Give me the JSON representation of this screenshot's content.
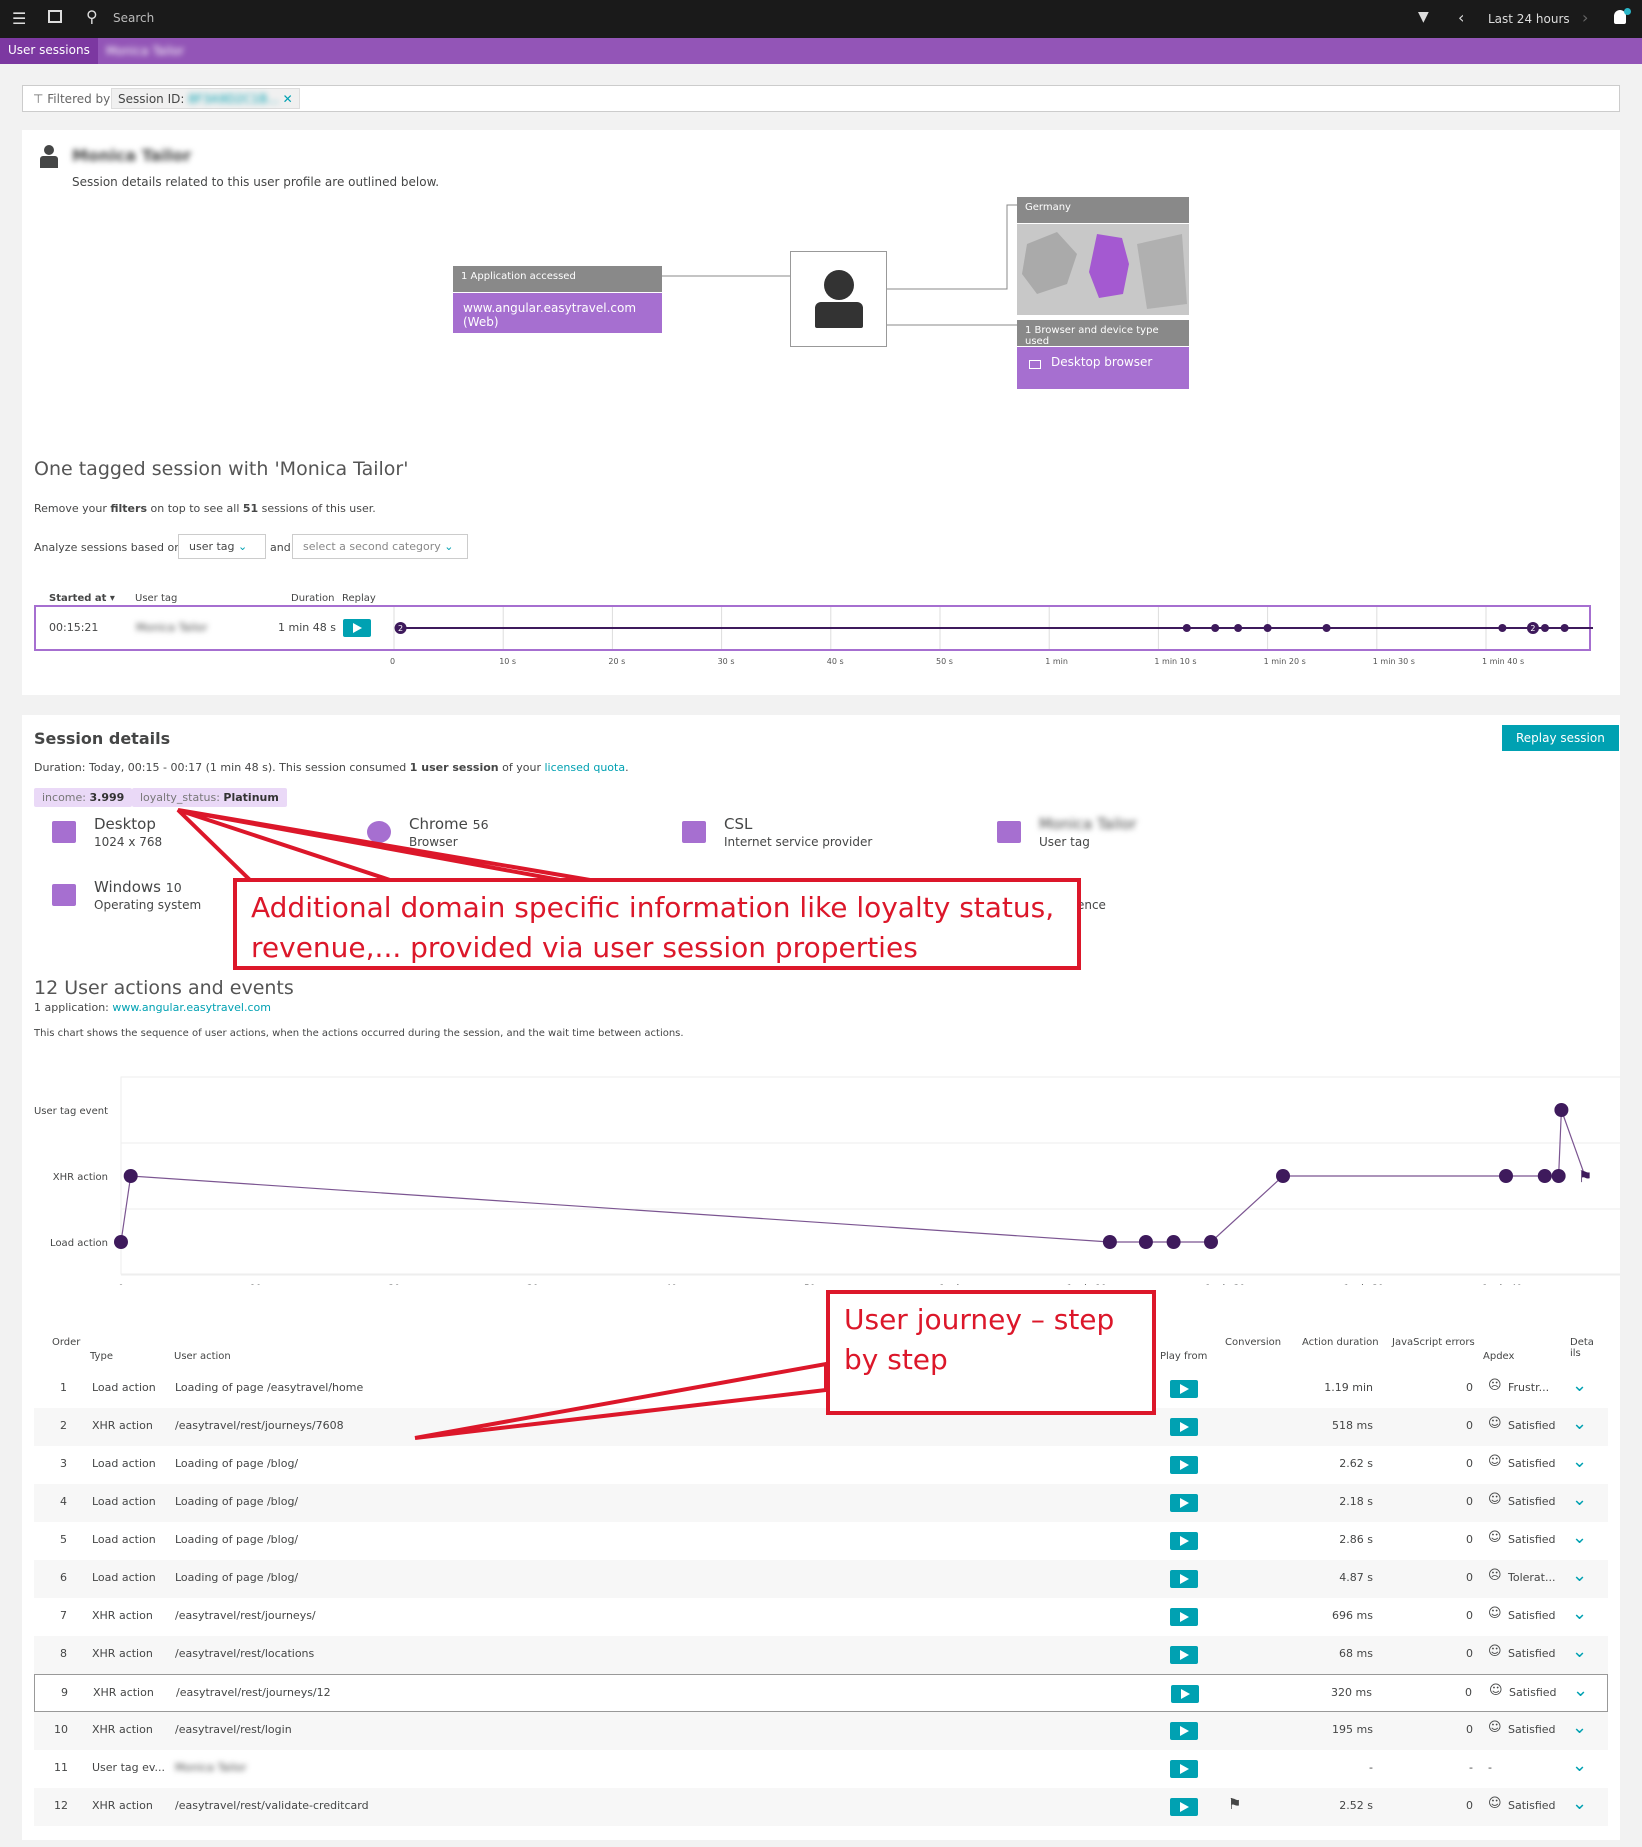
{
  "topbar": {
    "search_placeholder": "Search",
    "timeframe": "Last 24 hours"
  },
  "breadcrumb": {
    "root": "User sessions",
    "current": "Monica Tailor"
  },
  "filter": {
    "label": "Filtered by",
    "chip_key": "Session ID:",
    "chip_value": "8F3A9D2C1B..."
  },
  "profile": {
    "name": "Monica Tailor",
    "subtitle": "Session details related to this user profile are outlined below.",
    "app_header": "1 Application accessed",
    "app_value": "www.angular.easytravel.com (Web)",
    "country": "Germany",
    "browser_header": "1 Browser and device type used",
    "browser_value": "Desktop browser"
  },
  "tagged": {
    "title": "One tagged session with 'Monica Tailor'",
    "remove_pre": "Remove your ",
    "remove_filters": "filters",
    "remove_mid": " on top to see all ",
    "remove_count": "51",
    "remove_post": " sessions of this user.",
    "analyze_label": "Analyze sessions based on",
    "first_category": "user tag",
    "and": "and",
    "second_category": "select a second category",
    "columns": {
      "started": "Started at",
      "user_tag": "User tag",
      "duration": "Duration",
      "replay": "Replay"
    },
    "session": {
      "started": "00:15:21",
      "user_tag": "Monica Tailor",
      "duration": "1 min 48 s"
    },
    "ticks": [
      "0",
      "10 s",
      "20 s",
      "30 s",
      "40 s",
      "50 s",
      "1 min",
      "1 min 10 s",
      "1 min 20 s",
      "1 min 30 s",
      "1 min 40 s"
    ],
    "events_s": [
      0.6,
      72.6,
      75.2,
      77.3,
      80,
      85.4,
      101.5,
      104.3,
      105.4,
      107.2
    ],
    "badges": {
      "first": "2",
      "ninth": "2"
    }
  },
  "details": {
    "title": "Session details",
    "replay_button": "Replay session",
    "duration_pre": "Duration: Today, 00:15 - 00:17 (1 min 48 s). This session consumed ",
    "duration_bold": "1 user session",
    "duration_mid": " of your ",
    "quota_link": "licensed quota",
    "duration_post": ".",
    "properties": [
      {
        "key": "income:",
        "value": "3.999"
      },
      {
        "key": "loyalty_status:",
        "value": "Platinum"
      }
    ],
    "info": [
      {
        "icon": "desktop-icon",
        "title": "Desktop",
        "sub": "1024 x 768"
      },
      {
        "icon": "chrome-icon",
        "title": "Chrome",
        "ver": "56",
        "sub": "Browser"
      },
      {
        "icon": "isp-icon",
        "title": "CSL",
        "sub": "Internet service provider"
      },
      {
        "icon": "tag-icon",
        "title": "Monica Tailor",
        "sub": "User tag"
      },
      {
        "icon": "windows-icon",
        "title": "Windows",
        "ver": "10",
        "sub": "Operating system"
      },
      {
        "icon": "experience-icon",
        "title": "ated",
        "sub": "Experience"
      }
    ]
  },
  "annotation1": "Additional domain specific information like loyalty status, revenue,... provided via user session properties",
  "annotation2": "User journey – step by step",
  "actions": {
    "title": "12 User actions and events",
    "app_pre": "1 application: ",
    "app_link": "www.angular.easytravel.com",
    "description": "This chart shows the sequence of user actions, when the actions occurred during the session, and the wait time between actions."
  },
  "chart_data": {
    "type": "scatter",
    "categories": [
      "User tag event",
      "XHR action",
      "Load action"
    ],
    "x_ticks": [
      "0",
      "10 s",
      "20 s",
      "30 s",
      "40 s",
      "50 s",
      "1 min",
      "1 min 10 s",
      "1 min 20 s",
      "1 min 30 s",
      "1 min 40 s"
    ],
    "xlim": [
      0,
      107
    ],
    "points": [
      {
        "x": 0,
        "y": "Load action"
      },
      {
        "x": 0.7,
        "y": "XHR action"
      },
      {
        "x": 71.4,
        "y": "Load action"
      },
      {
        "x": 74,
        "y": "Load action"
      },
      {
        "x": 76,
        "y": "Load action"
      },
      {
        "x": 78.7,
        "y": "Load action"
      },
      {
        "x": 83.9,
        "y": "XHR action"
      },
      {
        "x": 100,
        "y": "XHR action"
      },
      {
        "x": 102.8,
        "y": "XHR action"
      },
      {
        "x": 103.8,
        "y": "XHR action"
      },
      {
        "x": 104,
        "y": "User tag event"
      },
      {
        "x": 105.7,
        "y": "XHR action",
        "marker": "flag"
      }
    ],
    "colors": {
      "point": "#3e1a5c",
      "line": "#7b5591"
    }
  },
  "table": {
    "headers": {
      "order": "Order",
      "type": "Type",
      "action": "User action",
      "play": "Play from",
      "conversion": "Conversion",
      "duration": "Action duration",
      "js": "JavaScript errors",
      "apdex": "Apdex",
      "details": "Details"
    },
    "rows": [
      [
        "1",
        "Load action",
        "Loading of page /easytravel/home",
        "",
        "1.19 min",
        "0",
        "Frustr..."
      ],
      [
        "2",
        "XHR action",
        "/easytravel/rest/journeys/7608",
        "",
        "518 ms",
        "0",
        "Satisfied"
      ],
      [
        "3",
        "Load action",
        "Loading of page /blog/",
        "",
        "2.62 s",
        "0",
        "Satisfied"
      ],
      [
        "4",
        "Load action",
        "Loading of page /blog/",
        "",
        "2.18 s",
        "0",
        "Satisfied"
      ],
      [
        "5",
        "Load action",
        "Loading of page /blog/",
        "",
        "2.86 s",
        "0",
        "Satisfied"
      ],
      [
        "6",
        "Load action",
        "Loading of page /blog/",
        "",
        "4.87 s",
        "0",
        "Tolerat..."
      ],
      [
        "7",
        "XHR action",
        "/easytravel/rest/journeys/",
        "",
        "696 ms",
        "0",
        "Satisfied"
      ],
      [
        "8",
        "XHR action",
        "/easytravel/rest/locations",
        "",
        "68 ms",
        "0",
        "Satisfied"
      ],
      [
        "9",
        "XHR action",
        "/easytravel/rest/journeys/12",
        "",
        "320 ms",
        "0",
        "Satisfied"
      ],
      [
        "10",
        "XHR action",
        "/easytravel/rest/login",
        "",
        "195 ms",
        "0",
        "Satisfied"
      ],
      [
        "11",
        "User tag ev...",
        "Monica Tailor",
        "",
        "-",
        "-",
        "-"
      ],
      [
        "12",
        "XHR action",
        "/easytravel/rest/validate-creditcard",
        "flag",
        "2.52 s",
        "0",
        "Satisfied"
      ]
    ]
  }
}
